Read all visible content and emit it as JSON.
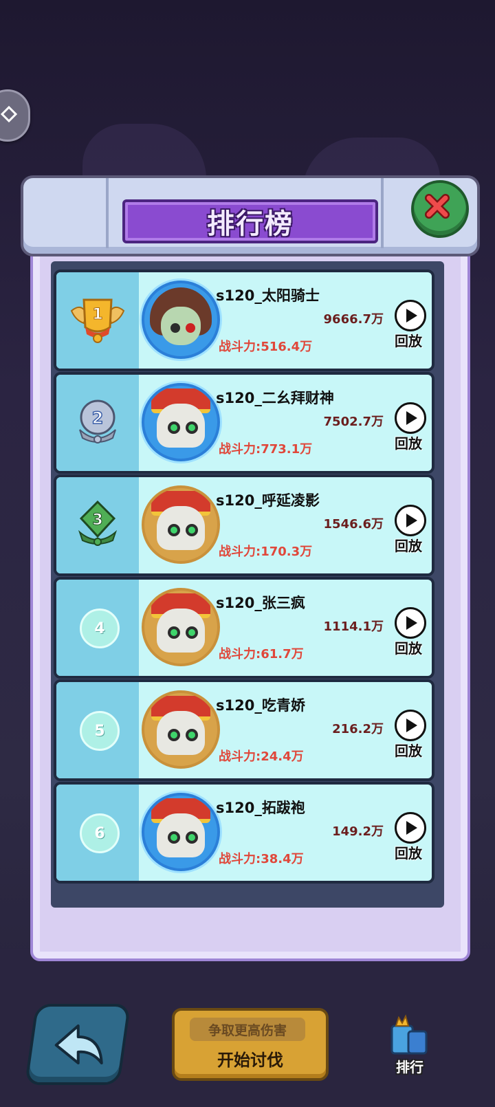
{
  "title": "排行榜",
  "replay_label": "回放",
  "entries": [
    {
      "rank": "1",
      "name": "s120_太阳骑士",
      "damage": "9666.7万",
      "power": "战斗力:516.4万",
      "avatar": "girl-blue"
    },
    {
      "rank": "2",
      "name": "s120_二幺拜财神",
      "damage": "7502.7万",
      "power": "战斗力:773.1万",
      "avatar": "skull-blue"
    },
    {
      "rank": "3",
      "name": "s120_呼延凌影",
      "damage": "1546.6万",
      "power": "战斗力:170.3万",
      "avatar": "skull-gold"
    },
    {
      "rank": "4",
      "name": "s120_张三疯",
      "damage": "1114.1万",
      "power": "战斗力:61.7万",
      "avatar": "skull-gold"
    },
    {
      "rank": "5",
      "name": "s120_吃青娇",
      "damage": "216.2万",
      "power": "战斗力:24.4万",
      "avatar": "skull-gold"
    },
    {
      "rank": "6",
      "name": "s120_拓跋袍",
      "damage": "149.2万",
      "power": "战斗力:38.4万",
      "avatar": "skull-blue"
    }
  ],
  "bottom": {
    "start_sub": "争取更高伤害",
    "start_main": "开始讨伐",
    "rank_tab": "排行"
  },
  "colors": {
    "power": "#e0473a",
    "damage": "#6b1e1e",
    "row_bg": "#c8f7f8",
    "title_ribbon": "#8a4bd0"
  }
}
